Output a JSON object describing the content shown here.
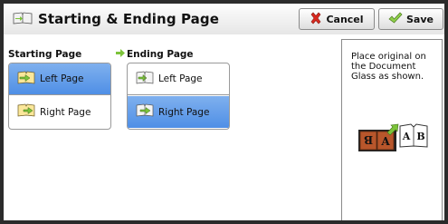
{
  "header": {
    "title": "Starting & Ending Page",
    "cancel_label": "Cancel",
    "save_label": "Save"
  },
  "starting_page": {
    "label": "Starting Page",
    "options": [
      {
        "label": "Left Page",
        "selected": true
      },
      {
        "label": "Right Page",
        "selected": false
      }
    ]
  },
  "ending_page": {
    "label": "Ending Page",
    "options": [
      {
        "label": "Left Page",
        "selected": false
      },
      {
        "label": "Right Page",
        "selected": true
      }
    ]
  },
  "instruction": {
    "text": "Place original on the Document Glass as shown.",
    "illustration_letters": [
      "B",
      "A",
      "A",
      "B"
    ]
  },
  "colors": {
    "selected": "#5a97e8",
    "arrow_green": "#7cc33a",
    "cancel_x": "#d9291f",
    "book_brown": "#b8562b"
  },
  "icons": {
    "title": "book-pages-icon",
    "cancel": "cancel-x-icon",
    "save": "checkmark-icon",
    "left_page": "left-page-arrow-icon",
    "right_page": "right-page-arrow-icon",
    "ending_marker": "green-arrow-icon"
  }
}
